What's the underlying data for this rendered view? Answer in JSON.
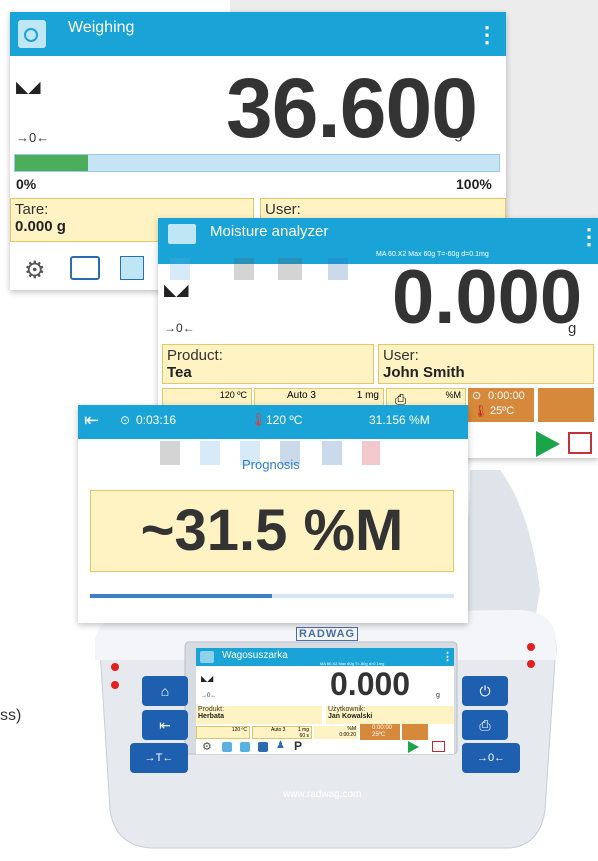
{
  "weighing": {
    "title": "Weighing",
    "value": "36.600",
    "unit": "g",
    "zero_indicator": "→0←",
    "progress_pct": 15,
    "bar_min": "0%",
    "bar_max": "100%",
    "tare_label": "Tare:",
    "tare_value": "0.000 g",
    "user_label": "User:"
  },
  "moisture": {
    "title": "Moisture analyzer",
    "spec": "MA 60.X2   Max 60g   T=-60g   d=0.1mg",
    "value": "0.000",
    "unit": "g",
    "zero_indicator": "→0←",
    "product_label": "Product:",
    "product_value": "Tea",
    "user_label": "User:",
    "user_value": "John Smith",
    "temp": "120 ºC",
    "mode": "Auto 3",
    "mg": "1 mg",
    "moist_unit": "%M",
    "timer": "0:00:00",
    "ambient": "25ºC"
  },
  "prognosis": {
    "elapsed": "0:03:16",
    "temp": "120 ºC",
    "current": "31.156 %M",
    "label": "Prognosis",
    "value": "~31.5 %M",
    "progress_pct": 50
  },
  "device": {
    "logo": "RADWAG",
    "url": "www.radwag.com",
    "side_text": "ss)",
    "buttons_right_3": "→0←",
    "buttons_left_3": "→T←"
  },
  "mini": {
    "title": "Wagosuszarka",
    "spec": "MA 60.X2  Max 60g  T=-60g  d=0.1mg",
    "value": "0.000",
    "unit": "g",
    "zero_indicator": "→0←",
    "product_label": "Produkt:",
    "product_value": "Herbata",
    "user_label": "Użytkownik:",
    "user_value": "Jan Kowalski",
    "temp": "120 ºC",
    "mode": "Auto 3",
    "mg": "1 mg",
    "time_s": "60 s",
    "moist_unit": "%M",
    "timer": "0:00:00",
    "ambient": "25ºC",
    "time2": "0:00:20"
  }
}
